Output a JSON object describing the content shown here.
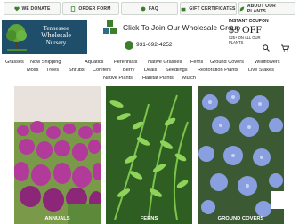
{
  "topbar": {
    "buttons": [
      {
        "label": "WE DONATE",
        "icon": "heart-icon"
      },
      {
        "label": "ORDER FORM",
        "icon": "document-icon"
      },
      {
        "label": "FAQ",
        "icon": "question-icon"
      },
      {
        "label": "GIFT CERTIFICATES",
        "icon": "gift-icon"
      },
      {
        "label": "ABOUT OUR PLANTS",
        "icon": "leaf-icon"
      }
    ]
  },
  "logo": {
    "line1": "Tennessee",
    "line2": "Wholesale",
    "line3": "Nursery"
  },
  "header": {
    "wholesale_text": "Click To Join Our Wholesale Group",
    "phone": "931-692-4252"
  },
  "coupon": {
    "line1": "INSTANT COUPON",
    "line2": "$5 OFF",
    "line3": "$25+ ON ALL OUR PLANTS"
  },
  "nav": {
    "items": [
      "Grasses",
      "Now Shipping",
      "Aquatics",
      "Perennials",
      "Native Grasses",
      "Ferns",
      "Ground Covers",
      "Wildflowers",
      "Moss",
      "Trees",
      "Shrubs",
      "Conifers",
      "Berry",
      "Deals",
      "Seedlings",
      "Restoration Plants",
      "Live Stakes",
      "Native Plants",
      "Habitat Plants",
      "Mulch"
    ]
  },
  "tiles": [
    {
      "label": "ANNUALS"
    },
    {
      "label": "FERNS"
    },
    {
      "label": "GROUND COVERS"
    }
  ],
  "colors": {
    "logo_bg": "#1f4e6b",
    "brand_green": "#3d7f2d"
  }
}
